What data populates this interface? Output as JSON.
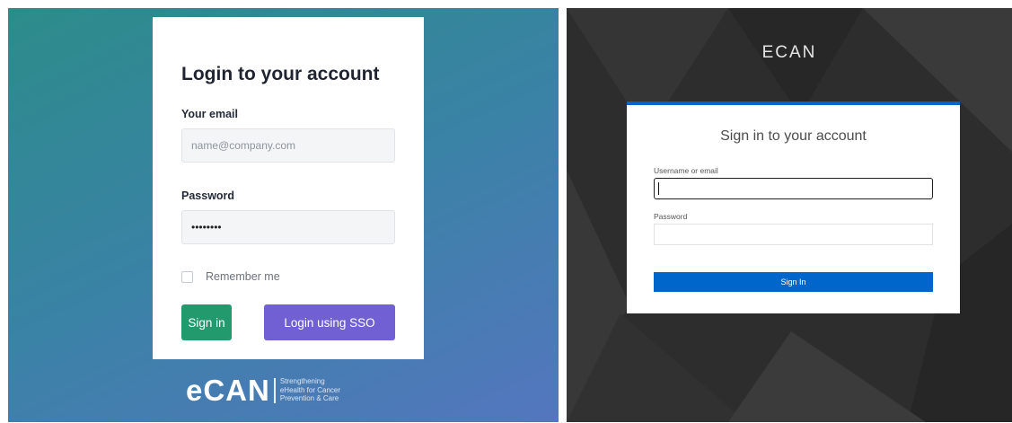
{
  "ecan_login": {
    "title": "Login to your account",
    "email_label": "Your email",
    "email_placeholder": "name@company.com",
    "password_label": "Password",
    "password_value": "••••••••",
    "remember_label": "Remember me",
    "sign_in_label": "Sign in",
    "sso_label": "Login using SSO",
    "logo_text": "eCAN",
    "logo_tagline": [
      "Strengthening",
      "eHealth for Cancer",
      "Prevention & Care"
    ]
  },
  "keycloak_login": {
    "brand": "ECAN",
    "title": "Sign in to your account",
    "username_label": "Username or email",
    "password_label": "Password",
    "sign_in_label": "Sign In"
  },
  "colors": {
    "sign_in_green": "#229a6e",
    "sso_purple": "#7160d3",
    "keycloak_blue": "#0066cc",
    "dark_background": "#2d2d2d"
  }
}
